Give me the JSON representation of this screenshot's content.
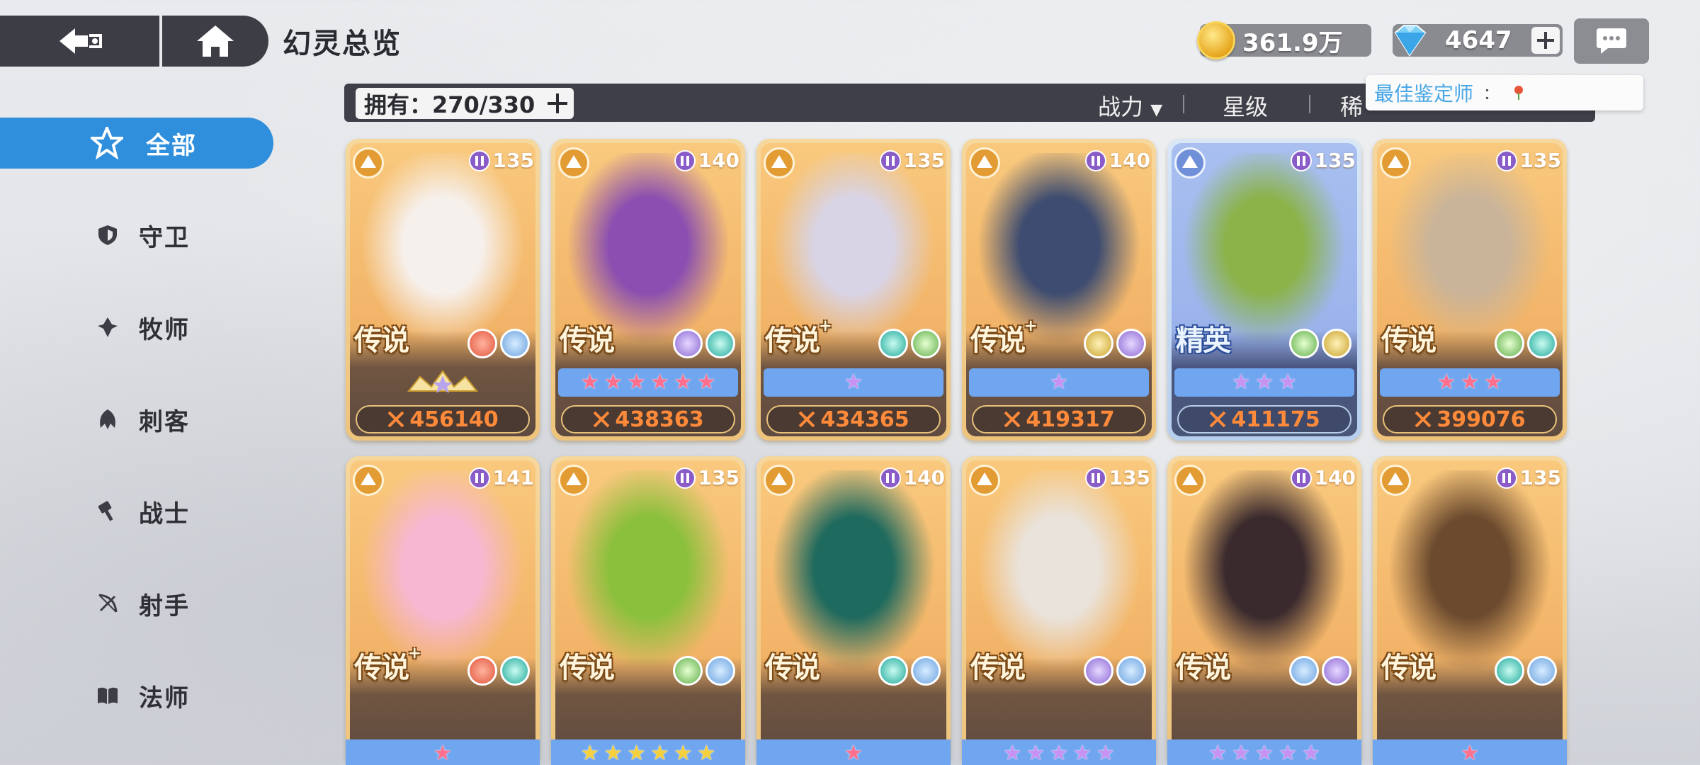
{
  "header": {
    "title": "幻灵总览"
  },
  "currency": {
    "gold": "361.9万",
    "gems": "4647"
  },
  "filter": {
    "owned_label": "拥有：270/330",
    "sort_power": "战力",
    "sort_star": "星级",
    "sort_rarity": "稀"
  },
  "tooltip": {
    "text": "最佳鉴定师",
    "sep": "："
  },
  "sidebar": {
    "items": [
      {
        "label": "全部",
        "icon": "all-icon"
      },
      {
        "label": "守卫",
        "icon": "shield-icon"
      },
      {
        "label": "牧师",
        "icon": "priest-icon"
      },
      {
        "label": "刺客",
        "icon": "assassin-icon"
      },
      {
        "label": "战士",
        "icon": "warrior-icon"
      },
      {
        "label": "射手",
        "icon": "bow-icon"
      },
      {
        "label": "法师",
        "icon": "book-icon"
      }
    ]
  },
  "cards_row1": [
    {
      "level": "135",
      "rarity": "传说",
      "plus": "",
      "elements": [
        "fire",
        "ice"
      ],
      "stars": 0,
      "crown": true,
      "power": "456140",
      "art": "#f6f0ec"
    },
    {
      "level": "140",
      "rarity": "传说",
      "plus": "",
      "elements": [
        "void",
        "water"
      ],
      "stars": 6,
      "star_color": "pink",
      "power": "438363",
      "art": "#8a4fb0"
    },
    {
      "level": "135",
      "rarity": "传说",
      "plus": "+",
      "elements": [
        "water",
        "leaf"
      ],
      "stars": 1,
      "star_color": "purple",
      "power": "434365",
      "art": "#d8d4e6"
    },
    {
      "level": "140",
      "rarity": "传说",
      "plus": "+",
      "elements": [
        "gold",
        "void"
      ],
      "stars": 1,
      "star_color": "purple",
      "power": "419317",
      "art": "#3d4c70"
    },
    {
      "level": "135",
      "rarity": "精英",
      "plus": "",
      "elements": [
        "leaf",
        "gold"
      ],
      "stars": 3,
      "star_color": "purple",
      "power": "411175",
      "art": "#8bb34a",
      "elite": true
    },
    {
      "level": "135",
      "rarity": "传说",
      "plus": "",
      "elements": [
        "leaf",
        "water"
      ],
      "stars": 3,
      "star_color": "pink",
      "power": "399076",
      "art": "#c9b49a"
    }
  ],
  "cards_row2": [
    {
      "level": "141",
      "rarity": "传说",
      "plus": "+",
      "elements": [
        "fire",
        "water"
      ],
      "stars": 1,
      "star_color": "pink",
      "art": "#f7b7d2"
    },
    {
      "level": "135",
      "rarity": "传说",
      "plus": "",
      "elements": [
        "leaf",
        "ice"
      ],
      "stars": 6,
      "star_color": "gold",
      "art": "#8ac03b"
    },
    {
      "level": "140",
      "rarity": "传说",
      "plus": "",
      "elements": [
        "water",
        "ice"
      ],
      "stars": 1,
      "star_color": "pink",
      "art": "#1f6a5e"
    },
    {
      "level": "135",
      "rarity": "传说",
      "plus": "",
      "elements": [
        "void",
        "ice"
      ],
      "stars": 5,
      "star_color": "purple",
      "art": "#e9e3dc"
    },
    {
      "level": "140",
      "rarity": "传说",
      "plus": "",
      "elements": [
        "ice",
        "void"
      ],
      "stars": 5,
      "star_color": "purple",
      "art": "#3a2a2e"
    },
    {
      "level": "135",
      "rarity": "传说",
      "plus": "",
      "elements": [
        "water",
        "ice"
      ],
      "stars": 1,
      "star_color": "pink",
      "art": "#6b4a2e"
    }
  ]
}
